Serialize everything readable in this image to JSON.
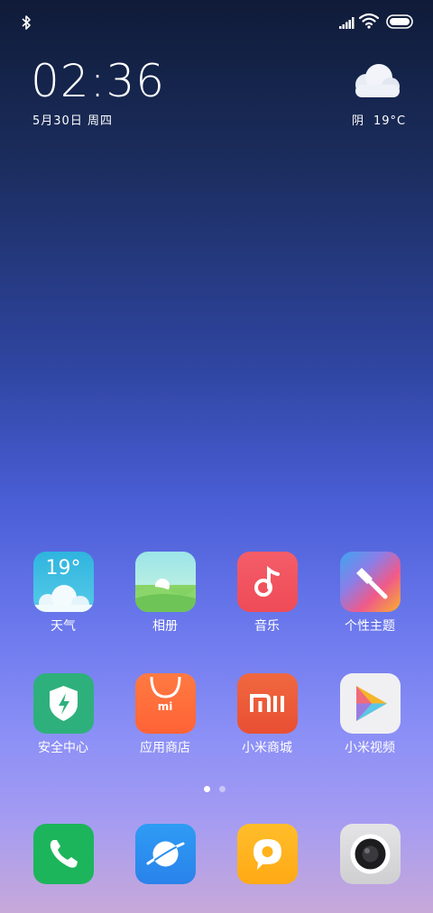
{
  "status_bar": {
    "icons": [
      "bluetooth-icon",
      "signal-icon",
      "wifi-icon",
      "battery-icon"
    ]
  },
  "clock": {
    "time": "02:36",
    "date": "5月30日 周四"
  },
  "weather": {
    "icon": "cloud-icon",
    "condition": "阴",
    "temperature": "19°C"
  },
  "apps_row1": [
    {
      "label": "天气",
      "icon": "weather-icon",
      "icon_text": "19°"
    },
    {
      "label": "相册",
      "icon": "gallery-icon"
    },
    {
      "label": "音乐",
      "icon": "music-icon"
    },
    {
      "label": "个性主题",
      "icon": "themes-icon"
    }
  ],
  "apps_row2": [
    {
      "label": "安全中心",
      "icon": "security-icon"
    },
    {
      "label": "应用商店",
      "icon": "app-store-icon",
      "icon_text": "mi"
    },
    {
      "label": "小米商城",
      "icon": "mi-store-icon"
    },
    {
      "label": "小米视频",
      "icon": "video-icon"
    }
  ],
  "page_indicator": {
    "pages": 2,
    "current": 1
  },
  "dock": [
    {
      "icon": "phone-icon"
    },
    {
      "icon": "browser-icon"
    },
    {
      "icon": "messages-icon"
    },
    {
      "icon": "camera-icon"
    }
  ],
  "colors": {
    "weather": "#3cc2e0",
    "gallery": "#7ed07a",
    "music": "#f2525e",
    "security": "#2db07a",
    "app_store": "#ff6a3c",
    "mi_store": "#f05a3a",
    "video": "#f0f0f0",
    "phone": "#1cb55a",
    "browser": "#2a8ef0",
    "messages": "#ffb21c",
    "camera": "#d8d8d8"
  }
}
